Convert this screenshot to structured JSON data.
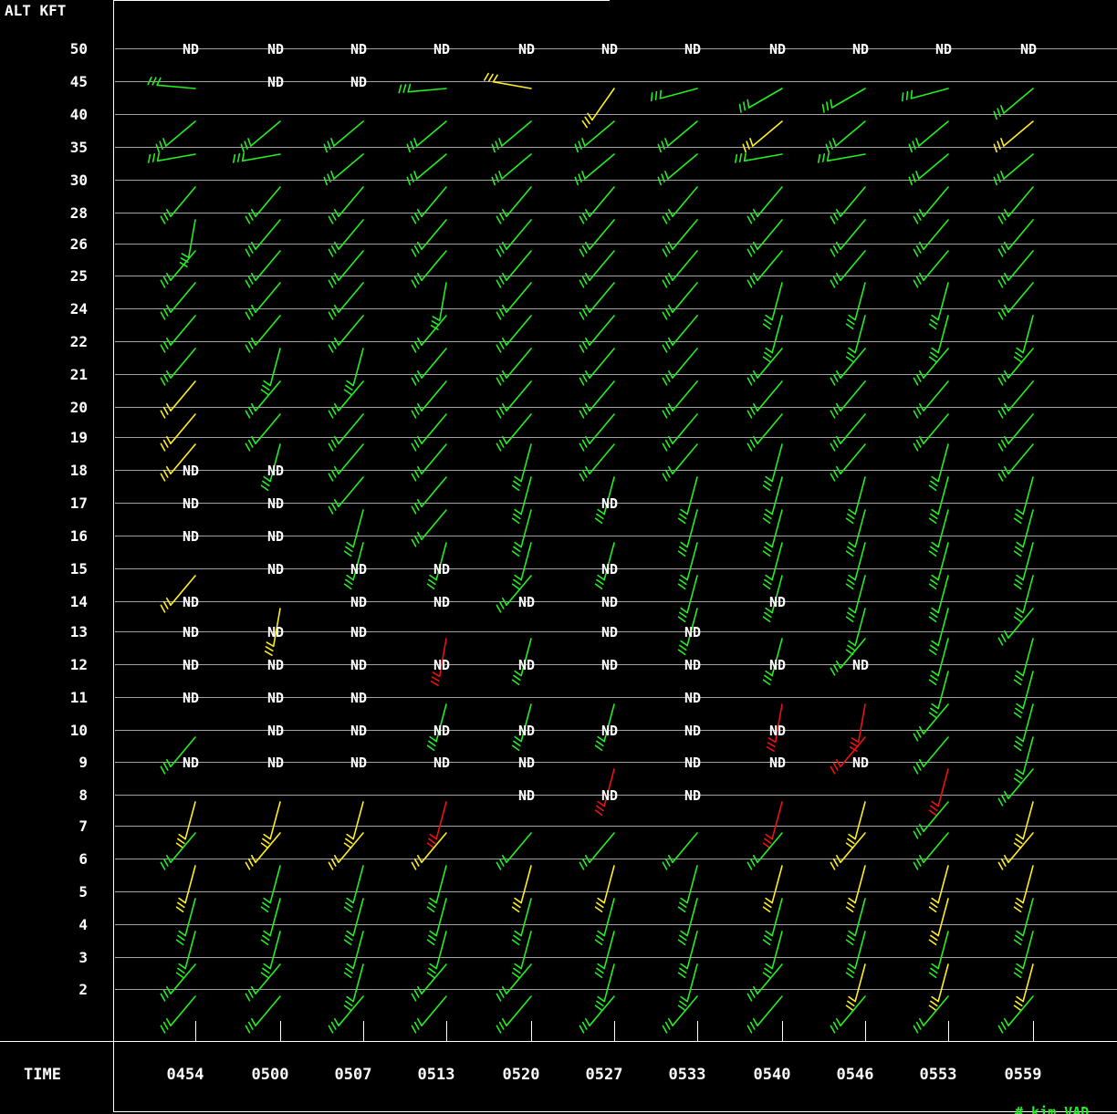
{
  "chart_data": {
    "type": "wind-barb-time-height",
    "y_axis_title": "ALT KFT",
    "x_axis_title": "TIME",
    "altitudes": [
      "50",
      "45",
      "40",
      "35",
      "30",
      "28",
      "26",
      "25",
      "24",
      "22",
      "21",
      "20",
      "19",
      "18",
      "17",
      "16",
      "15",
      "14",
      "13",
      "12",
      "11",
      "10",
      "9",
      "8",
      "7",
      "6",
      "5",
      "4",
      "3",
      "2"
    ],
    "times": [
      "0454",
      "0500",
      "0507",
      "0513",
      "0520",
      "0527",
      "0533",
      "0540",
      "0546",
      "0553",
      "0559"
    ],
    "nd_label": "ND",
    "colors": {
      "G": "#22ee22",
      "Y": "#ffee22",
      "R": "#ee1111"
    },
    "legend_fragment": "# kim VAD",
    "cells": [
      [
        "N",
        "N",
        "N",
        "N",
        "N",
        "N",
        "N",
        "N",
        "N",
        "N",
        "N"
      ],
      [
        "G:95",
        "N",
        "N",
        "G:85",
        "Y:100",
        "Y:35",
        "G:75",
        "G:60",
        "G:60",
        "G:75",
        "G:50"
      ],
      [
        "G:50",
        "G:50",
        "G:50",
        "G:50",
        "G:50",
        "G:50",
        "G:50",
        "Y:50",
        "G:50",
        "G:50",
        "Y:50"
      ],
      [
        "G:80",
        "G:80",
        "G:50",
        "G:50",
        "G:50",
        "G:50",
        "G:50",
        "G:80",
        "G:80",
        "G:50",
        "G:50"
      ],
      [
        "G:40",
        "G:40",
        "G:40",
        "G:40",
        "G:40",
        "G:40",
        "G:40",
        "G:40",
        "G:40",
        "G:40",
        "G:40"
      ],
      [
        "G:10",
        "G:40",
        "G:40",
        "G:40",
        "G:40",
        "G:40",
        "G:40",
        "G:40",
        "G:40",
        "G:40",
        "G:40"
      ],
      [
        "G:40",
        "G:40",
        "G:40",
        "G:40",
        "G:40",
        "G:40",
        "G:40",
        "G:40",
        "G:40",
        "G:40",
        "G:40"
      ],
      [
        "G:40",
        "G:40",
        "G:40",
        "G:10",
        "G:40",
        "G:40",
        "G:40",
        "G:15",
        "G:15",
        "G:15",
        "G:40"
      ],
      [
        "G:40",
        "G:40",
        "G:40",
        "G:40",
        "G:40",
        "G:40",
        "G:40",
        "G:15",
        "G:15",
        "G:15",
        "G:15"
      ],
      [
        "G:40",
        "G:15",
        "G:15",
        "G:40",
        "G:40",
        "G:40",
        "G:40",
        "G:40",
        "G:40",
        "G:40",
        "G:40"
      ],
      [
        "Y:40",
        "G:40",
        "G:40",
        "G:40",
        "G:40",
        "G:40",
        "G:40",
        "G:40",
        "G:40",
        "G:40",
        "G:40"
      ],
      [
        "Y:40",
        "G:40",
        "G:40",
        "G:40",
        "G:40",
        "G:40",
        "G:40",
        "G:40",
        "G:40",
        "G:40",
        "G:40"
      ],
      [
        "Y:40",
        "G:15",
        "G:40",
        "G:40",
        "G:15",
        "G:40",
        "G:40",
        "G:15",
        "G:40",
        "G:15",
        "G:40"
      ],
      [
        "N",
        "N",
        "G:40",
        "G:40",
        "G:15",
        "G:15",
        "G:15",
        "G:15",
        "G:15",
        "G:15",
        "G:15"
      ],
      [
        "N",
        "N",
        "G:15",
        "G:40",
        "G:15",
        "N",
        "G:15",
        "G:15",
        "G:15",
        "G:15",
        "G:15"
      ],
      [
        "N",
        "N",
        "G:15",
        "G:15",
        "G:15",
        "G:15",
        "G:15",
        "G:15",
        "G:15",
        "G:15",
        "G:15"
      ],
      [
        "Y:40",
        "N",
        "N",
        "N",
        "G:40",
        "N",
        "G:15",
        "G:15",
        "G:15",
        "G:15",
        "G:15"
      ],
      [
        "N",
        "Y:10",
        "N",
        "N",
        "N",
        "N",
        "G:15",
        "N",
        "G:15",
        "G:15",
        "G:40"
      ],
      [
        "N",
        "N",
        "N",
        "R:10",
        "G:15",
        "N",
        "N",
        "G:15",
        "G:40",
        "G:15",
        "G:15"
      ],
      [
        "N",
        "N",
        "N",
        "N",
        "N",
        "N",
        "N",
        "N",
        "N",
        "G:15",
        "G:15"
      ],
      [
        "N",
        "N",
        "N",
        "G:15",
        "G:15",
        "G:15",
        "N",
        "R:10",
        "R:10",
        "G:40",
        "G:15"
      ],
      [
        "G:40",
        "N",
        "N",
        "N",
        "N",
        "N",
        "N",
        "N",
        "R:40",
        "G:40",
        "G:15"
      ],
      [
        "N",
        "N",
        "N",
        "N",
        "N",
        "R:15",
        "N",
        "N",
        "N",
        "R:15",
        "G:40"
      ],
      [
        "Y:15",
        "Y:15",
        "Y:15",
        "R:15",
        "N",
        "N",
        "N",
        "R:15",
        "Y:15",
        "G:40",
        "Y:15"
      ],
      [
        "G:40",
        "Y:40",
        "Y:40",
        "Y:40",
        "G:40",
        "G:40",
        "G:40",
        "G:40",
        "Y:40",
        "G:40",
        "Y:40"
      ],
      [
        "Y:15",
        "G:15",
        "G:15",
        "G:15",
        "Y:15",
        "Y:15",
        "G:15",
        "Y:15",
        "Y:15",
        "Y:15",
        "Y:15"
      ],
      [
        "G:15",
        "G:15",
        "G:15",
        "G:15",
        "G:15",
        "G:15",
        "G:15",
        "G:15",
        "G:15",
        "Y:15",
        "G:15"
      ],
      [
        "G:15",
        "G:15",
        "G:15",
        "G:15",
        "G:15",
        "G:15",
        "G:15",
        "G:15",
        "G:15",
        "G:15",
        "G:15"
      ],
      [
        "G:40",
        "G:40",
        "G:15",
        "G:40",
        "G:40",
        "G:15",
        "G:15",
        "G:40",
        "Y:15",
        "Y:15",
        "Y:15"
      ],
      [
        "G:40",
        "G:40",
        "G:40",
        "G:40",
        "G:40",
        "G:40",
        "G:40",
        "G:40",
        "G:40",
        "G:40",
        "G:40"
      ]
    ]
  }
}
